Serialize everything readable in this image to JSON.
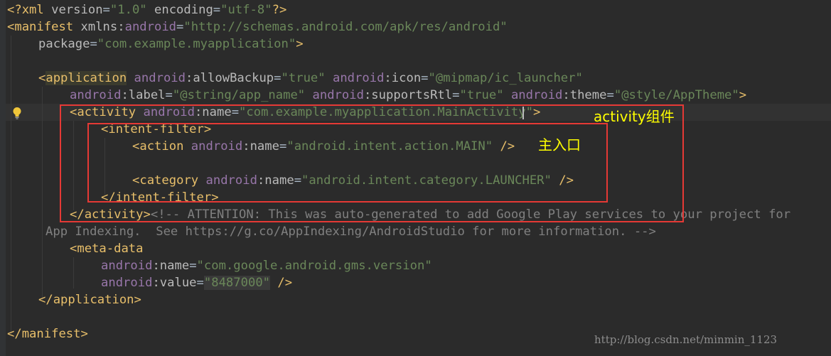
{
  "editor": {
    "lines": [
      {
        "id": "xml-decl",
        "tokens": [
          {
            "t": "punc",
            "v": "<?"
          },
          {
            "t": "tag",
            "v": "xml "
          },
          {
            "t": "attr",
            "v": "version"
          },
          {
            "t": "eq",
            "v": "="
          },
          {
            "t": "str",
            "v": "\"1.0\""
          },
          {
            "t": "attr",
            "v": " encoding"
          },
          {
            "t": "eq",
            "v": "="
          },
          {
            "t": "str",
            "v": "\"utf-8\""
          },
          {
            "t": "punc",
            "v": "?>"
          }
        ]
      },
      {
        "id": "manifest-open",
        "tokens": [
          {
            "t": "punc",
            "v": "<"
          },
          {
            "t": "tag",
            "v": "manifest "
          },
          {
            "t": "attr",
            "v": "xmlns:"
          },
          {
            "t": "ns",
            "v": "android"
          },
          {
            "t": "eq",
            "v": "="
          },
          {
            "t": "str",
            "v": "\"http://schemas.android.com/apk/res/android\""
          }
        ]
      },
      {
        "id": "package-attr",
        "tokens": [
          {
            "t": "attr",
            "v": "package"
          },
          {
            "t": "eq",
            "v": "="
          },
          {
            "t": "str",
            "v": "\"com.example.myapplication\""
          },
          {
            "t": "punc",
            "v": ">"
          }
        ]
      },
      {
        "id": "blank-1",
        "tokens": []
      },
      {
        "id": "application-open",
        "tokens": [
          {
            "t": "punc",
            "v": "<"
          },
          {
            "t": "tag",
            "v": "application",
            "hl": "app"
          },
          {
            "t": "eq",
            "v": " "
          },
          {
            "t": "ns",
            "v": "android"
          },
          {
            "t": "attr",
            "v": ":allowBackup"
          },
          {
            "t": "eq",
            "v": "="
          },
          {
            "t": "str",
            "v": "\"true\""
          },
          {
            "t": "eq",
            "v": " "
          },
          {
            "t": "ns",
            "v": "android"
          },
          {
            "t": "attr",
            "v": ":icon"
          },
          {
            "t": "eq",
            "v": "="
          },
          {
            "t": "str",
            "v": "\"@mipmap/ic_launcher\""
          }
        ]
      },
      {
        "id": "application-attrs",
        "tokens": [
          {
            "t": "ns",
            "v": "android"
          },
          {
            "t": "attr",
            "v": ":label"
          },
          {
            "t": "eq",
            "v": "="
          },
          {
            "t": "str",
            "v": "\"@string/app_name\""
          },
          {
            "t": "eq",
            "v": " "
          },
          {
            "t": "ns",
            "v": "android"
          },
          {
            "t": "attr",
            "v": ":supportsRtl"
          },
          {
            "t": "eq",
            "v": "="
          },
          {
            "t": "str",
            "v": "\"true\""
          },
          {
            "t": "eq",
            "v": " "
          },
          {
            "t": "ns",
            "v": "android"
          },
          {
            "t": "attr",
            "v": ":theme"
          },
          {
            "t": "eq",
            "v": "="
          },
          {
            "t": "str",
            "v": "\"@style/AppTheme\""
          },
          {
            "t": "punc",
            "v": ">"
          }
        ]
      },
      {
        "id": "activity-open",
        "tokens": [
          {
            "t": "punc",
            "v": "<"
          },
          {
            "t": "tag",
            "v": "activity "
          },
          {
            "t": "ns",
            "v": "android"
          },
          {
            "t": "attr",
            "v": ":name"
          },
          {
            "t": "eq",
            "v": "="
          },
          {
            "t": "str",
            "v": "\"com.example.myapplication.MainActivity\""
          },
          {
            "t": "punc",
            "v": ">"
          }
        ]
      },
      {
        "id": "intent-filter-open",
        "tokens": [
          {
            "t": "punc",
            "v": "<"
          },
          {
            "t": "tag",
            "v": "intent-filter"
          },
          {
            "t": "punc",
            "v": ">"
          }
        ]
      },
      {
        "id": "action-main",
        "tokens": [
          {
            "t": "punc",
            "v": "<"
          },
          {
            "t": "tag",
            "v": "action "
          },
          {
            "t": "ns",
            "v": "android"
          },
          {
            "t": "attr",
            "v": ":name"
          },
          {
            "t": "eq",
            "v": "="
          },
          {
            "t": "str",
            "v": "\"android.intent.action.MAIN\""
          },
          {
            "t": "punc",
            "v": " />"
          }
        ]
      },
      {
        "id": "blank-2",
        "tokens": []
      },
      {
        "id": "category-launcher",
        "tokens": [
          {
            "t": "punc",
            "v": "<"
          },
          {
            "t": "tag",
            "v": "category "
          },
          {
            "t": "ns",
            "v": "android"
          },
          {
            "t": "attr",
            "v": ":name"
          },
          {
            "t": "eq",
            "v": "="
          },
          {
            "t": "str",
            "v": "\"android.intent.category.LAUNCHER\""
          },
          {
            "t": "punc",
            "v": " />"
          }
        ]
      },
      {
        "id": "intent-filter-close",
        "tokens": [
          {
            "t": "punc",
            "v": "</"
          },
          {
            "t": "tag",
            "v": "intent-filter"
          },
          {
            "t": "punc",
            "v": ">"
          }
        ]
      },
      {
        "id": "activity-close",
        "tokens": [
          {
            "t": "punc",
            "v": "</"
          },
          {
            "t": "tag",
            "v": "activity"
          },
          {
            "t": "punc",
            "v": ">"
          },
          {
            "t": "cmt",
            "v": "<!-- ATTENTION: This was auto-generated to add Google Play services to your project for"
          }
        ]
      },
      {
        "id": "comment-cont",
        "tokens": [
          {
            "t": "cmt",
            "v": "App Indexing.  See https://g.co/AppIndexing/AndroidStudio for more information. -->"
          }
        ]
      },
      {
        "id": "meta-data-open",
        "tokens": [
          {
            "t": "punc",
            "v": "<"
          },
          {
            "t": "tag",
            "v": "meta-data"
          }
        ]
      },
      {
        "id": "meta-name",
        "tokens": [
          {
            "t": "ns",
            "v": "android"
          },
          {
            "t": "attr",
            "v": ":name"
          },
          {
            "t": "eq",
            "v": "="
          },
          {
            "t": "str",
            "v": "\"com.google.android.gms.version\""
          }
        ]
      },
      {
        "id": "meta-value",
        "tokens": [
          {
            "t": "ns",
            "v": "android"
          },
          {
            "t": "attr",
            "v": ":value"
          },
          {
            "t": "eq",
            "v": "="
          },
          {
            "t": "str",
            "v": "\"8487000\"",
            "hl": "val"
          },
          {
            "t": "punc",
            "v": " />"
          }
        ]
      },
      {
        "id": "application-close",
        "tokens": [
          {
            "t": "punc",
            "v": "</"
          },
          {
            "t": "tag",
            "v": "application"
          },
          {
            "t": "punc",
            "v": ">"
          }
        ]
      },
      {
        "id": "blank-3",
        "tokens": []
      },
      {
        "id": "manifest-close",
        "tokens": [
          {
            "t": "punc",
            "v": "</"
          },
          {
            "t": "tag",
            "v": "manifest"
          },
          {
            "t": "punc",
            "v": ">"
          }
        ]
      }
    ]
  },
  "annotations": {
    "activity_label": "activity组件",
    "main_entry_label": "主入口"
  },
  "watermark": "http://blog.csdn.net/minmin_1123",
  "colors": {
    "background": "#2b2b2b",
    "tag": "#e8bf6a",
    "namespace": "#9876aa",
    "string": "#6a8759",
    "comment": "#808080",
    "annotation_box": "#e53935",
    "annotation_text": "#ffff00"
  },
  "icons": {
    "intention_bulb": "lightbulb-icon"
  }
}
